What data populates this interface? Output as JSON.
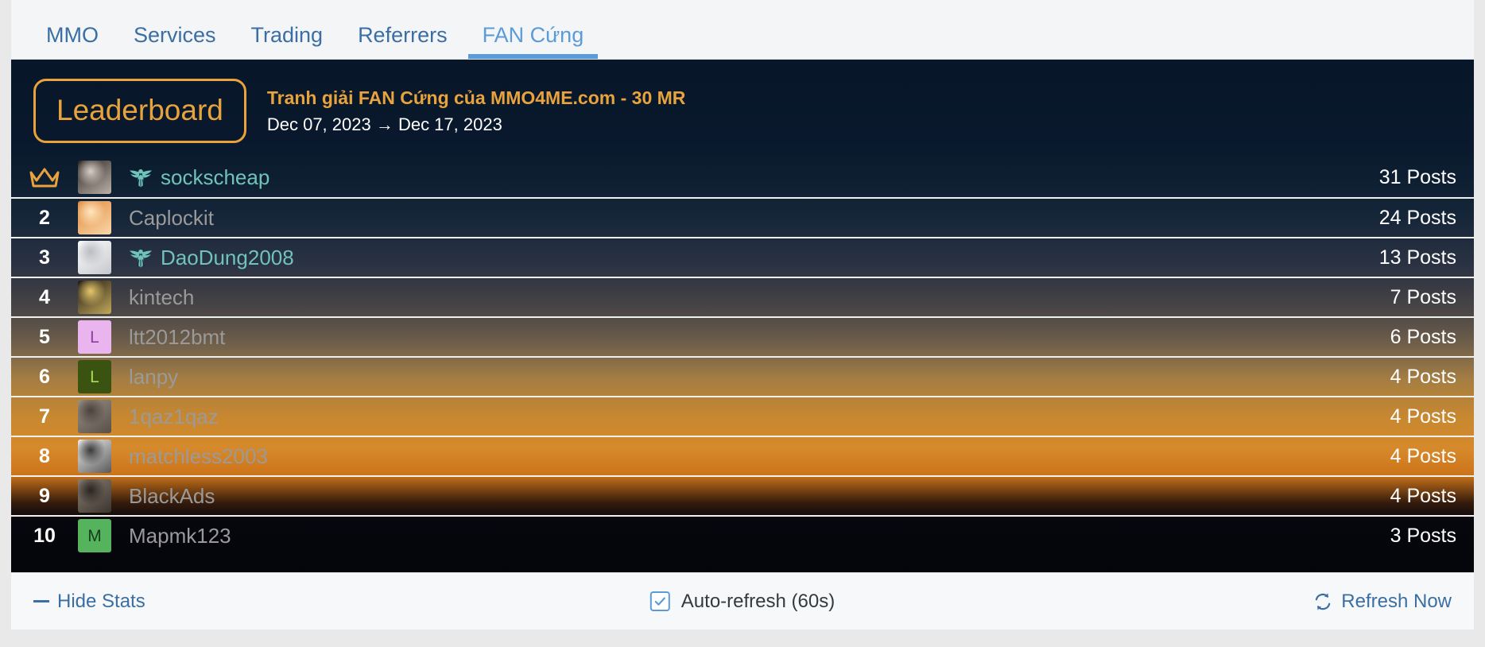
{
  "tabs": [
    {
      "label": "MMO",
      "active": false
    },
    {
      "label": "Services",
      "active": false
    },
    {
      "label": "Trading",
      "active": false
    },
    {
      "label": "Referrers",
      "active": false
    },
    {
      "label": "FAN Cứng",
      "active": true
    }
  ],
  "header": {
    "badge_label": "Leaderboard",
    "title": "Tranh giải FAN Cứng của MMO4ME.com - 30 MR",
    "dates": "Dec 07, 2023 → Dec 17, 2023",
    "date_start": "Dec 07, 2023",
    "date_end": "Dec 17, 2023"
  },
  "colors": {
    "accent_orange": "#e8a33d",
    "link_blue": "#3a6ea5",
    "active_tab_blue": "#5b9bd8",
    "teal_username": "#6fc3bb",
    "muted_username": "#9a9a9a"
  },
  "rows": [
    {
      "rank": "1",
      "crown": true,
      "username": "sockscheap",
      "posts": "31 Posts",
      "badge": true,
      "avatar_type": "image",
      "avatar_letter": "",
      "avatar_bg": "#2b2320",
      "avatar_fg": "#d8cfc6"
    },
    {
      "rank": "2",
      "crown": false,
      "username": "Caplockit",
      "posts": "24 Posts",
      "badge": false,
      "avatar_type": "image",
      "avatar_letter": "",
      "avatar_bg": "#e08a3a",
      "avatar_fg": "#ffe6c0"
    },
    {
      "rank": "3",
      "crown": false,
      "username": "DaoDung2008",
      "posts": "13 Posts",
      "badge": true,
      "avatar_type": "image",
      "avatar_letter": "",
      "avatar_bg": "#ffffff",
      "avatar_fg": "#b9bcc2"
    },
    {
      "rank": "4",
      "crown": false,
      "username": "kintech",
      "posts": "7 Posts",
      "badge": false,
      "avatar_type": "image",
      "avatar_letter": "",
      "avatar_bg": "#1b1512",
      "avatar_fg": "#e5c76a"
    },
    {
      "rank": "5",
      "crown": false,
      "username": "ltt2012bmt",
      "posts": "6 Posts",
      "badge": false,
      "avatar_type": "letter",
      "avatar_letter": "L",
      "avatar_bg": "#eab5ee",
      "avatar_fg": "#8f3ea0"
    },
    {
      "rank": "6",
      "crown": false,
      "username": "lanpy",
      "posts": "4 Posts",
      "badge": false,
      "avatar_type": "letter",
      "avatar_letter": "L",
      "avatar_bg": "#3b5310",
      "avatar_fg": "#a7dd55"
    },
    {
      "rank": "7",
      "crown": false,
      "username": "1qaz1qaz",
      "posts": "4 Posts",
      "badge": false,
      "avatar_type": "image",
      "avatar_letter": "",
      "avatar_bg": "#9a9086",
      "avatar_fg": "#4a423c"
    },
    {
      "rank": "8",
      "crown": false,
      "username": "matchless2003",
      "posts": "4 Posts",
      "badge": false,
      "avatar_type": "image",
      "avatar_letter": "",
      "avatar_bg": "#f2f2f2",
      "avatar_fg": "#3a3a3a"
    },
    {
      "rank": "9",
      "crown": false,
      "username": "BlackAds",
      "posts": "4 Posts",
      "badge": false,
      "avatar_type": "image",
      "avatar_letter": "",
      "avatar_bg": "#8b7f73",
      "avatar_fg": "#2a2420"
    },
    {
      "rank": "10",
      "crown": false,
      "username": "Mapmk123",
      "posts": "3 Posts",
      "badge": false,
      "avatar_type": "letter",
      "avatar_letter": "M",
      "avatar_bg": "#55b35e",
      "avatar_fg": "#16401b"
    }
  ],
  "footer": {
    "hide_stats_label": "Hide Stats",
    "autorefresh_label": "Auto-refresh (60s)",
    "autorefresh_checked": true,
    "refresh_now_label": "Refresh Now"
  }
}
